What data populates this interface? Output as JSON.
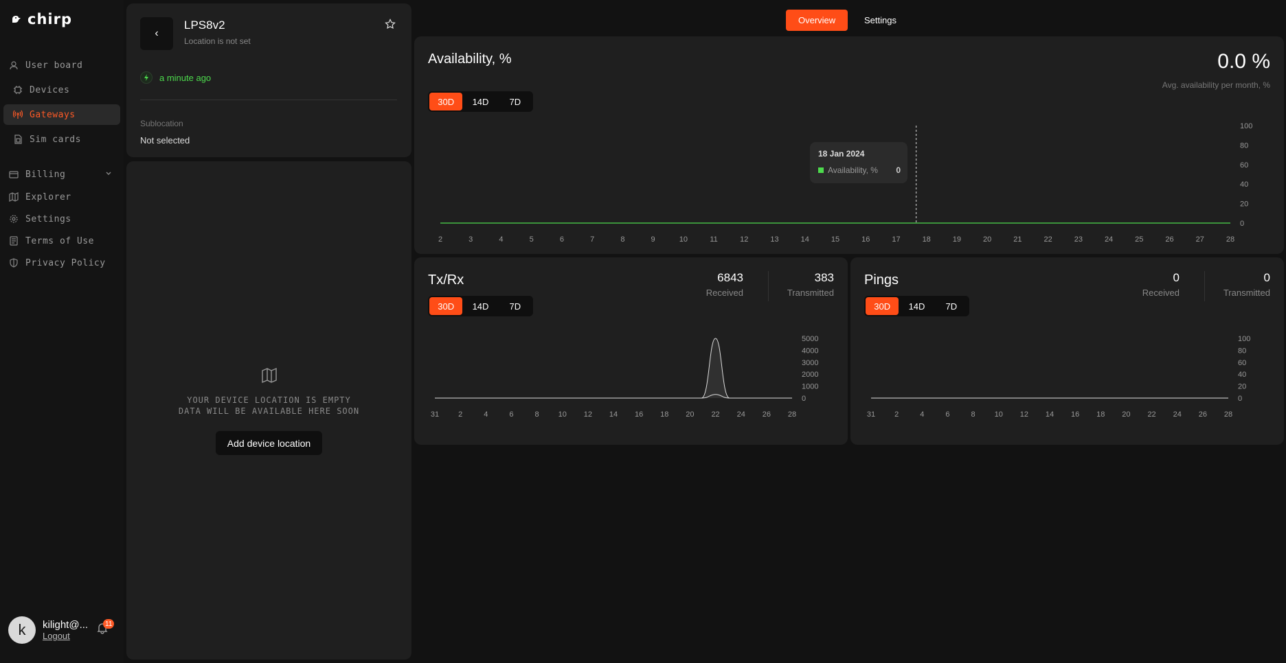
{
  "app": {
    "logo_text": "chirp"
  },
  "sidebar": {
    "items": [
      {
        "label": "User board"
      },
      {
        "label": "Devices"
      },
      {
        "label": "Gateways"
      },
      {
        "label": "Sim cards"
      },
      {
        "label": "Billing"
      },
      {
        "label": "Explorer"
      },
      {
        "label": "Settings"
      },
      {
        "label": "Terms of Use"
      },
      {
        "label": "Privacy Policy"
      }
    ],
    "user": {
      "initial": "k",
      "name": "kilight@...",
      "logout": "Logout"
    },
    "notifications": "11"
  },
  "device": {
    "name": "LPS8v2",
    "location": "Location is not set",
    "last_seen": "a minute ago",
    "sublocation_label": "Sublocation",
    "sublocation_value": "Not selected"
  },
  "location_panel": {
    "empty_line1": "YOUR DEVICE LOCATION IS EMPTY",
    "empty_line2": "DATA WILL BE AVAILABLE HERE SOON",
    "add_button": "Add device location"
  },
  "tabs": [
    "Overview",
    "Settings"
  ],
  "ranges": [
    "30D",
    "14D",
    "7D"
  ],
  "availability": {
    "title": "Availability, %",
    "value": "0.0 %",
    "subtitle": "Avg. availability per month, %",
    "tooltip": {
      "date": "18 Jan 2024",
      "series": "Availability, %",
      "value": "0"
    }
  },
  "txrx": {
    "title": "Tx/Rx",
    "received": "6843",
    "received_label": "Received",
    "transmitted": "383",
    "transmitted_label": "Transmitted"
  },
  "pings": {
    "title": "Pings",
    "received": "0",
    "received_label": "Received",
    "transmitted": "0",
    "transmitted_label": "Transmitted"
  },
  "colors": {
    "accent": "#ff4d17",
    "online": "#4ddb4d"
  },
  "chart_data": [
    {
      "type": "line",
      "title": "Availability, %",
      "x": [
        "2",
        "3",
        "4",
        "5",
        "6",
        "7",
        "8",
        "9",
        "10",
        "11",
        "12",
        "13",
        "14",
        "15",
        "16",
        "17",
        "18",
        "19",
        "20",
        "21",
        "22",
        "23",
        "24",
        "25",
        "26",
        "27",
        "28"
      ],
      "series": [
        {
          "name": "Availability, %",
          "values": [
            0,
            0,
            0,
            0,
            0,
            0,
            0,
            0,
            0,
            0,
            0,
            0,
            0,
            0,
            0,
            0,
            0,
            0,
            0,
            0,
            0,
            0,
            0,
            0,
            0,
            0,
            0
          ]
        }
      ],
      "yticks": [
        0,
        20,
        40,
        60,
        80,
        100
      ],
      "ylim": [
        0,
        100
      ]
    },
    {
      "type": "area",
      "title": "Tx/Rx",
      "x": [
        "31",
        "1",
        "2",
        "3",
        "4",
        "5",
        "6",
        "7",
        "8",
        "9",
        "10",
        "11",
        "12",
        "13",
        "14",
        "15",
        "16",
        "17",
        "18",
        "19",
        "20",
        "21",
        "22",
        "23",
        "24",
        "25",
        "26",
        "27",
        "28"
      ],
      "xticks": [
        "31",
        "2",
        "4",
        "6",
        "8",
        "10",
        "12",
        "14",
        "16",
        "18",
        "20",
        "22",
        "24",
        "26",
        "28"
      ],
      "series": [
        {
          "values": [
            0,
            0,
            0,
            0,
            0,
            0,
            0,
            0,
            0,
            0,
            0,
            0,
            0,
            0,
            0,
            0,
            0,
            0,
            0,
            0,
            0,
            0,
            5000,
            0,
            0,
            0,
            0,
            0,
            0
          ]
        },
        {
          "values": [
            0,
            0,
            0,
            0,
            0,
            0,
            0,
            0,
            0,
            0,
            0,
            0,
            0,
            0,
            0,
            0,
            0,
            0,
            0,
            0,
            0,
            0,
            300,
            0,
            0,
            0,
            0,
            0,
            0
          ]
        }
      ],
      "yticks": [
        0,
        1000,
        2000,
        3000,
        4000,
        5000
      ],
      "ylim": [
        0,
        5000
      ]
    },
    {
      "type": "line",
      "title": "Pings",
      "x": [
        "31",
        "1",
        "2",
        "3",
        "4",
        "5",
        "6",
        "7",
        "8",
        "9",
        "10",
        "11",
        "12",
        "13",
        "14",
        "15",
        "16",
        "17",
        "18",
        "19",
        "20",
        "21",
        "22",
        "23",
        "24",
        "25",
        "26",
        "27",
        "28"
      ],
      "xticks": [
        "31",
        "2",
        "4",
        "6",
        "8",
        "10",
        "12",
        "14",
        "16",
        "18",
        "20",
        "22",
        "24",
        "26",
        "28"
      ],
      "series": [
        {
          "values": [
            0,
            0,
            0,
            0,
            0,
            0,
            0,
            0,
            0,
            0,
            0,
            0,
            0,
            0,
            0,
            0,
            0,
            0,
            0,
            0,
            0,
            0,
            0,
            0,
            0,
            0,
            0,
            0,
            0
          ]
        }
      ],
      "yticks": [
        0,
        20,
        40,
        60,
        80,
        100
      ],
      "ylim": [
        0,
        100
      ]
    }
  ]
}
